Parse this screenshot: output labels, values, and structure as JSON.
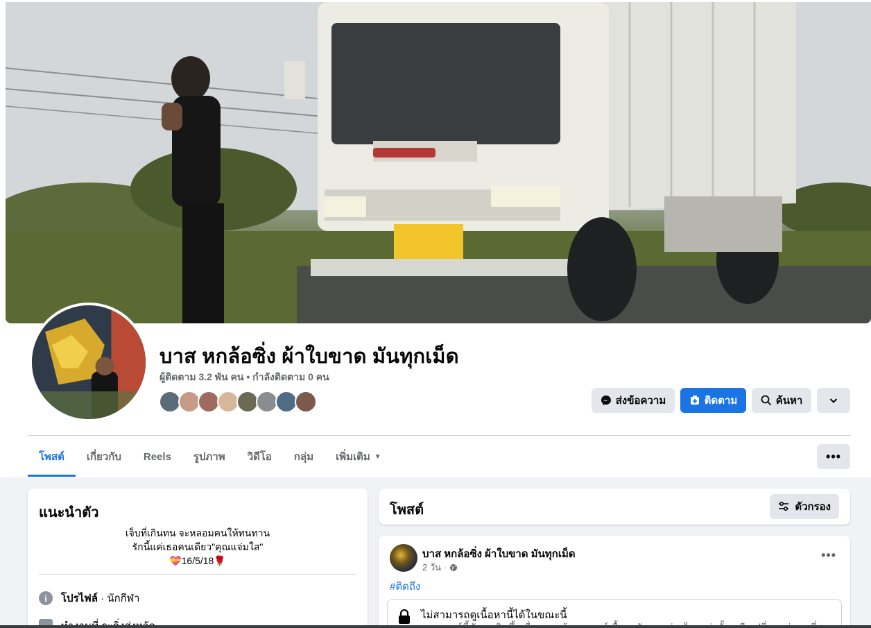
{
  "profile": {
    "name": "บาส หกล้อซิ่ง ผ้าใบขาด มันทุกเม็ด",
    "followers_line": "ผู้ติดตาม 3.2 พัน คน • กำลังติดตาม 0 คน"
  },
  "actions": {
    "message_label": "ส่งข้อความ",
    "follow_label": "ติดตาม",
    "search_label": "ค้นหา"
  },
  "tabs": [
    {
      "label": "โพสต์"
    },
    {
      "label": "เกี่ยวกับ"
    },
    {
      "label": "Reels"
    },
    {
      "label": "รูปภาพ"
    },
    {
      "label": "วิดีโอ"
    },
    {
      "label": "กลุ่ม"
    },
    {
      "label": "เพิ่มเติม"
    }
  ],
  "tab_more_label": "•••",
  "intro": {
    "title": "แนะนำตัว",
    "bio_line1": "เจ็บที่เกินทน จะหลอมคนให้ทนทาน",
    "bio_line2": "รักนี้แค่เธอคนเดียว\"คุณแจ่มใส\"",
    "bio_line3": "💝16/5/18🌹",
    "profile_label": "โปรไฟล์",
    "profile_category": " · นักกีฬา",
    "work_label": "ทำงานที่ ระดิ่งส่งหวัด"
  },
  "posts": {
    "title": "โพสต์",
    "filter_label": "ตัวกรอง"
  },
  "post": {
    "author": "บาส หกล้อซิ่ง ผ้าใบขาด มันทุกเม็ด",
    "time": "2 วัน ·",
    "more": "•••",
    "hashtag": "#ติดถึง",
    "unavailable_title": "ไม่สามารถดูเนื้อหานี้ได้ในขณะนี้",
    "unavailable_desc": "เหตุการณ์นี้มักจะเกิดขึ้นเนื่องจากเจ้าของแชร์เนื้อหากับคนกลุ่มเล็กๆ เท่านั้น หรือเปลี่ยนกลุ่มคนที่สามารถดูได้ หรือ"
  },
  "colors": {
    "accent": "#1b74e4",
    "secondary_text": "#65676b",
    "button_gray": "#e4e6eb",
    "page_bg": "#f0f2f5"
  },
  "friend_avatar_colors": [
    "#5a6c7a",
    "#c59a86",
    "#a06a5c",
    "#d7b79a",
    "#6c6a55",
    "#8a8c8f",
    "#4f6b86",
    "#7b5a4b"
  ]
}
